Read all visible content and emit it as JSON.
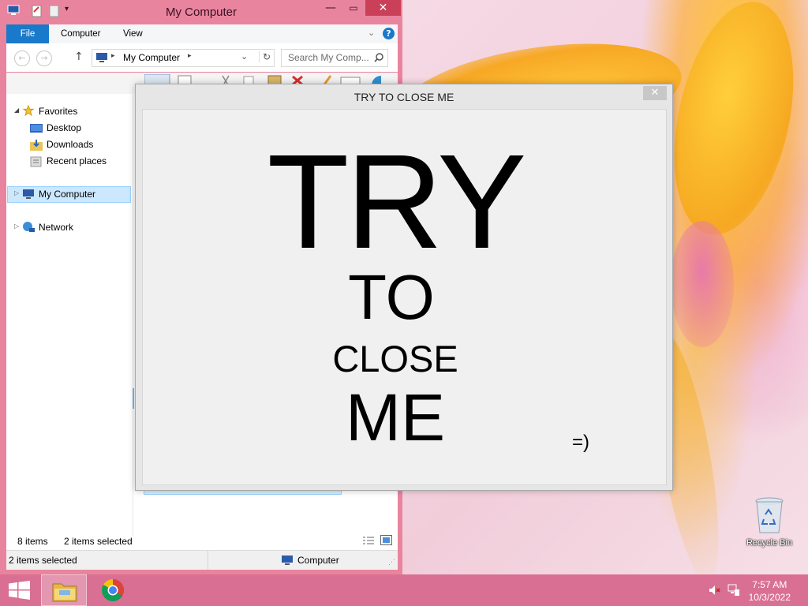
{
  "explorer": {
    "title": "My Computer",
    "tabs": [
      "File",
      "Computer",
      "View"
    ],
    "address": "My Computer",
    "search_placeholder": "Search My Comp...",
    "nav": {
      "favorites": "Favorites",
      "desktop": "Desktop",
      "downloads": "Downloads",
      "recent": "Recent places",
      "mycomputer": "My Computer",
      "network": "Network"
    },
    "status": {
      "items": "8 items",
      "selected": "2 items selected",
      "bottom_left": "2 items selected",
      "bottom_right": "Computer"
    }
  },
  "popup": {
    "title": "TRY TO CLOSE ME",
    "line1": "TRY",
    "line2": "TO",
    "line3": "CLOSE",
    "line4": "ME",
    "smiley": "=)"
  },
  "desktop": {
    "recycle_bin": "Recycle Bin"
  },
  "taskbar": {
    "time": "7:57 AM",
    "date": "10/3/2022"
  },
  "colors": {
    "window_border": "#e9849f",
    "taskbar": "#d96f92",
    "file_tab": "#1979ca"
  }
}
